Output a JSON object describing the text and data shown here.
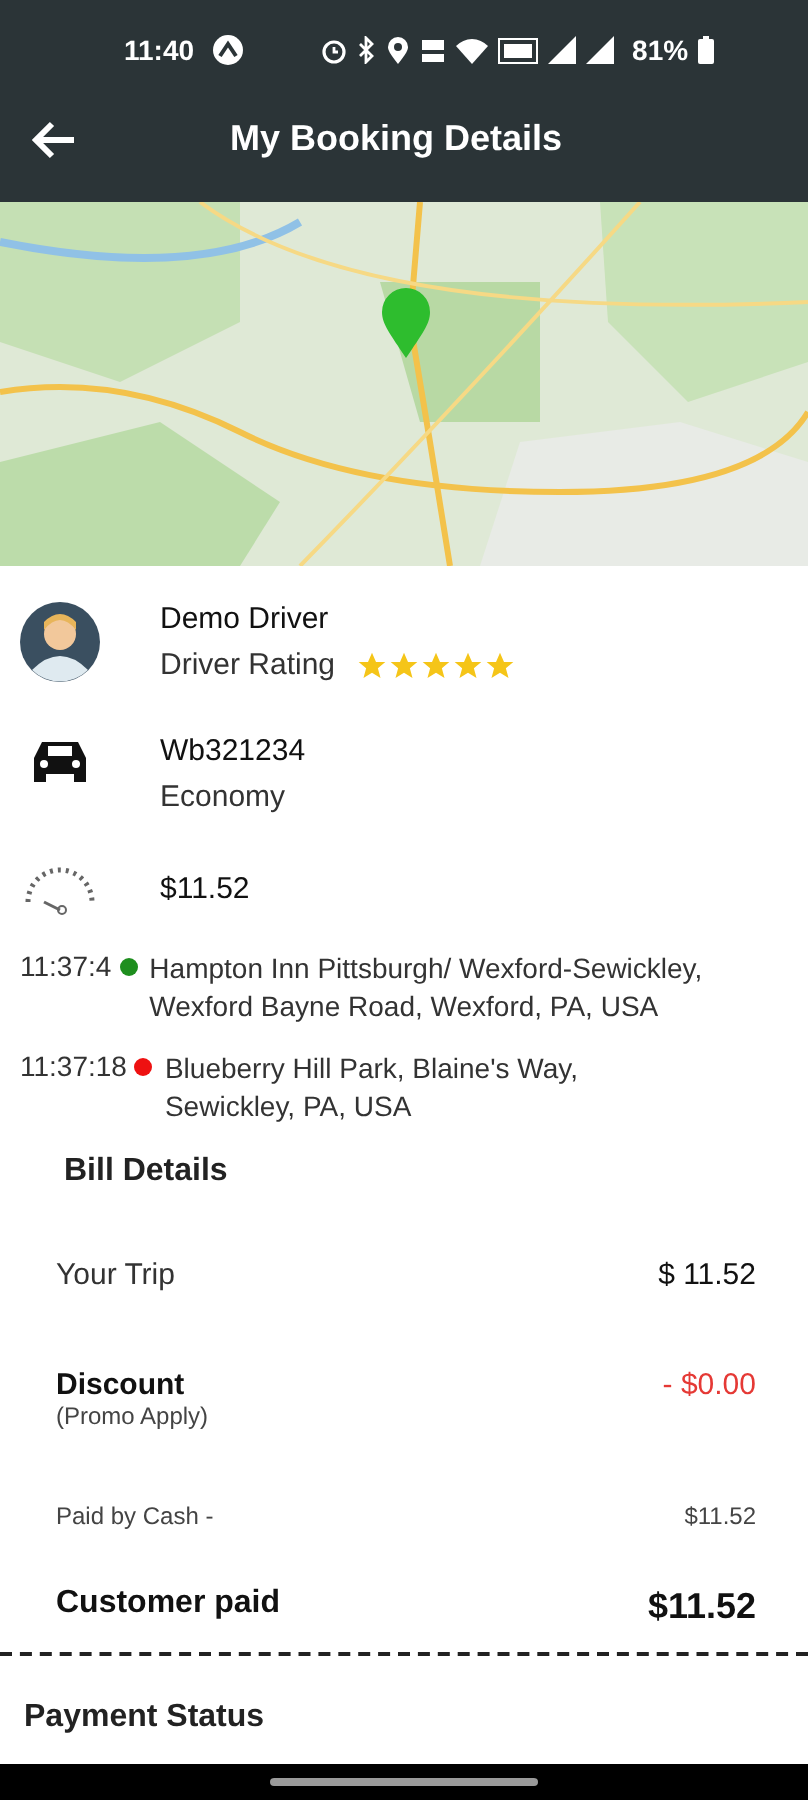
{
  "status_bar": {
    "time": "11:40",
    "battery": "81%"
  },
  "header": {
    "title": "My Booking Details"
  },
  "driver": {
    "name": "Demo Driver",
    "rating_label": "Driver Rating",
    "stars": 5
  },
  "vehicle": {
    "number": "Wb321234",
    "type": "Economy"
  },
  "fare": {
    "amount": "$11.52"
  },
  "locations": [
    {
      "time": "11:37:4",
      "color": "#1e8e1e",
      "address_lines": [
        "Hampton Inn Pittsburgh/ Wexford-Sewickley,",
        "Wexford Bayne Road, Wexford, PA, USA"
      ]
    },
    {
      "time": "11:37:18",
      "color": "#ee1111",
      "address_lines": [
        "Blueberry Hill Park, Blaine's Way,",
        "Sewickley, PA, USA"
      ]
    }
  ],
  "bill": {
    "title": "Bill Details",
    "rows": [
      {
        "kind": "plain",
        "label": "Your Trip",
        "value": "$ 11.52"
      },
      {
        "kind": "discount",
        "label": "Discount",
        "note": "(Promo Apply)",
        "value": "- $0.00"
      },
      {
        "kind": "small",
        "label": "Paid by Cash -",
        "value": "$11.52"
      },
      {
        "kind": "total",
        "label": "Customer paid",
        "value": "$11.52"
      }
    ]
  },
  "payment_status": {
    "title": "Payment Status"
  }
}
